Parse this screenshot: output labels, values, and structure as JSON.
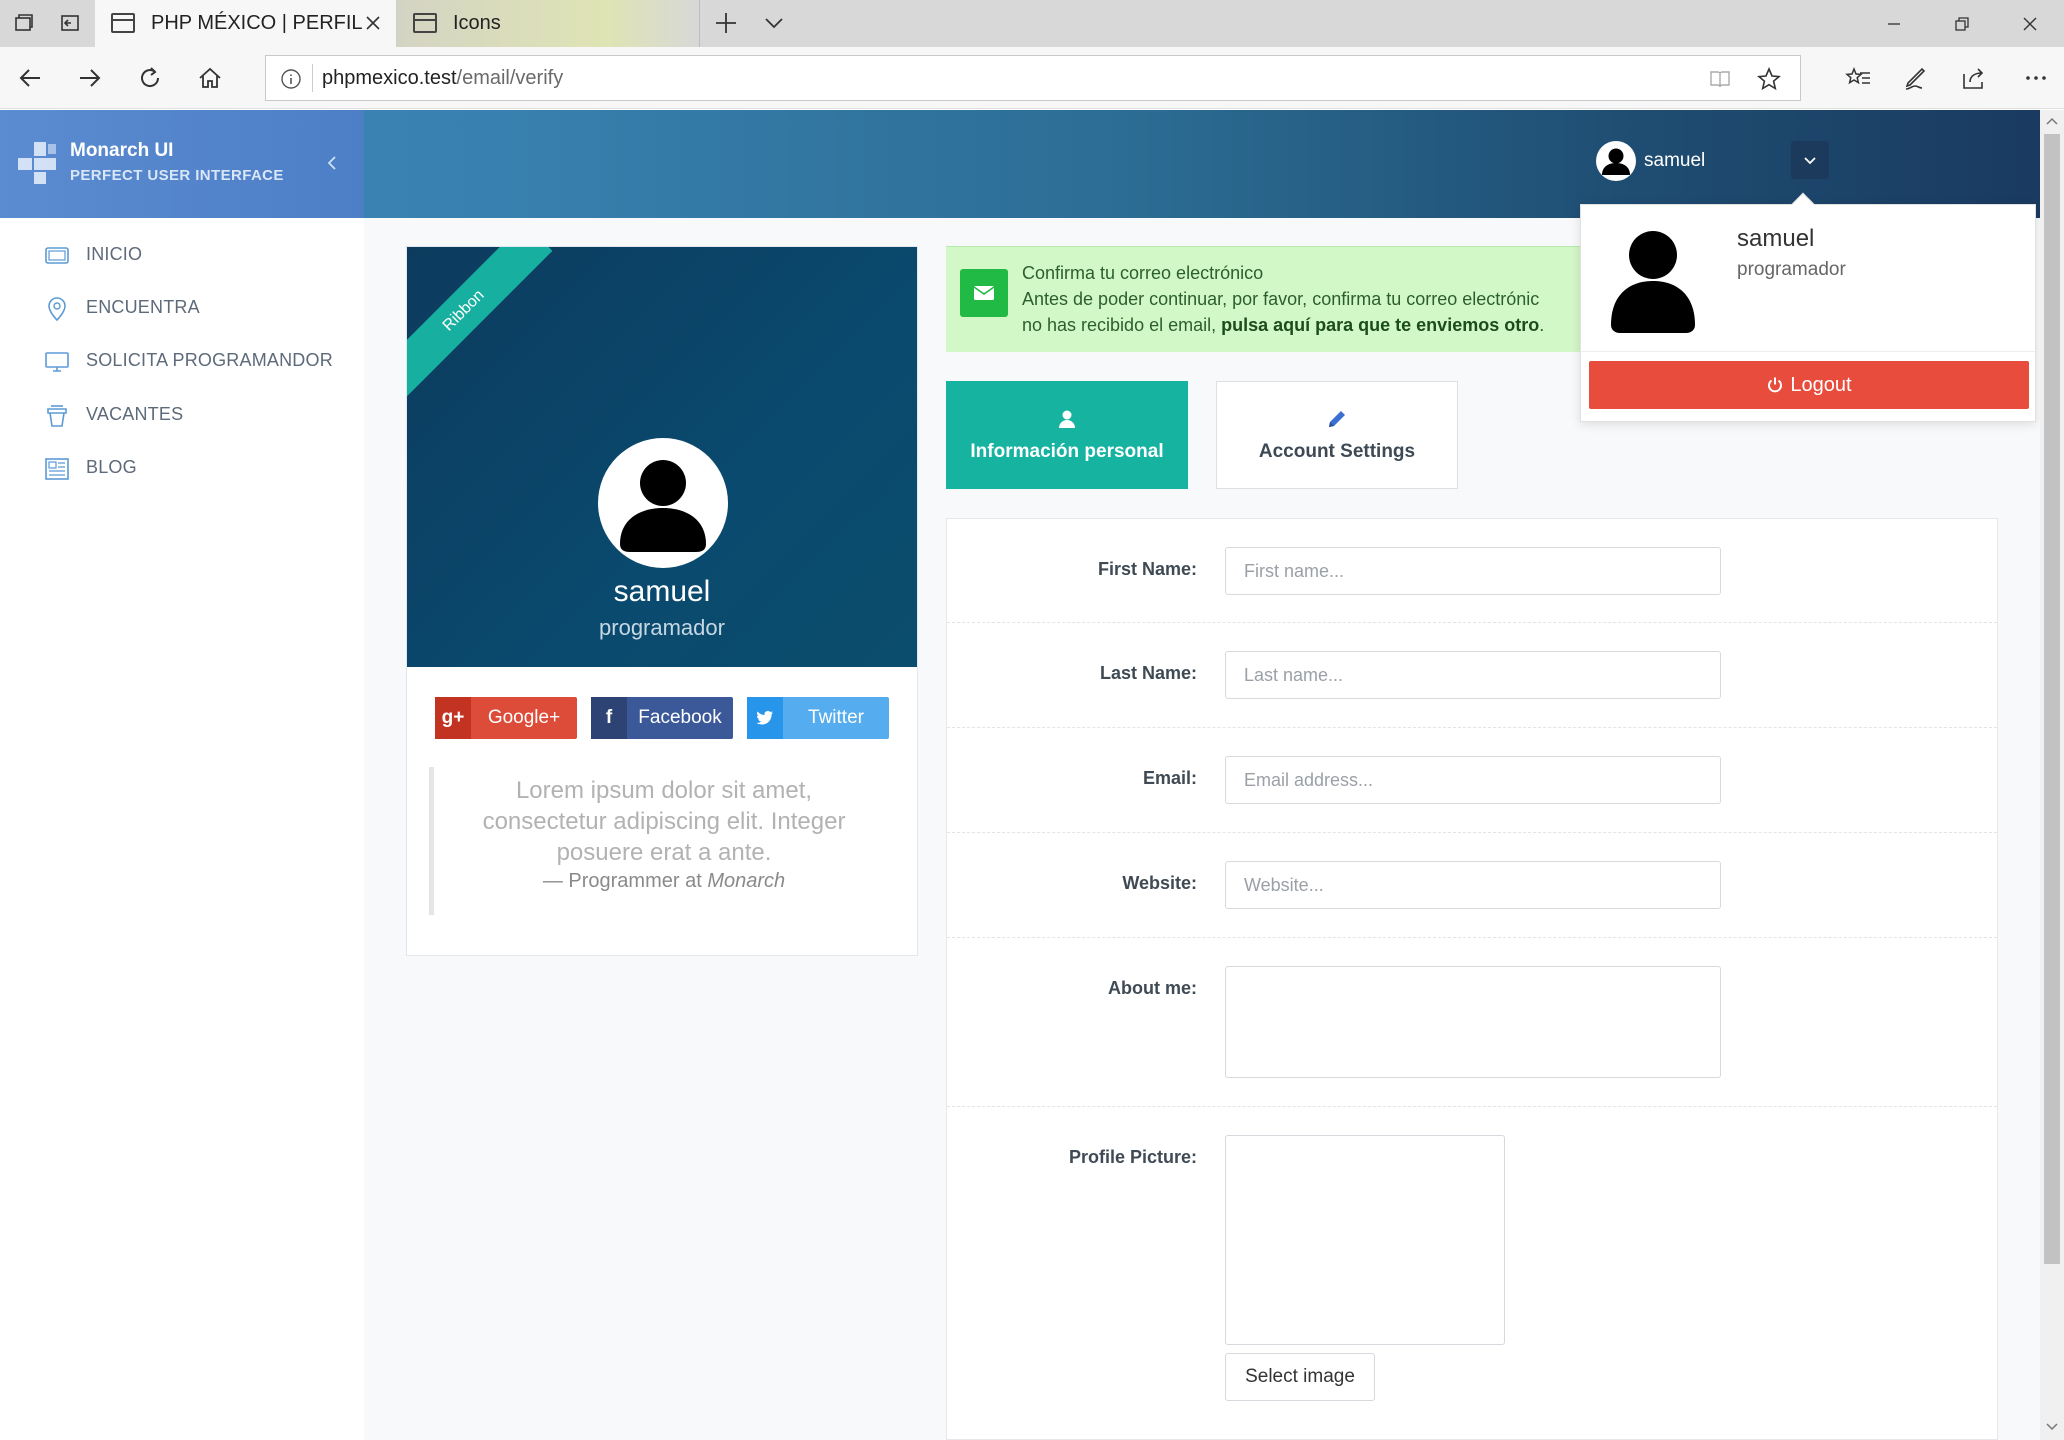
{
  "browser": {
    "tabs": [
      {
        "title": "PHP MÉXICO | PERFIL",
        "active": true
      },
      {
        "title": "Icons",
        "active": false
      }
    ],
    "url_host": "phpmexico.test",
    "url_path": "/email/verify",
    "icons": [
      "tab-set-aside-icon",
      "tab-preview-icon",
      "new-tab-icon",
      "tab-list-icon",
      "minimize-icon",
      "restore-icon",
      "close-window-icon",
      "back-icon",
      "forward-icon",
      "refresh-icon",
      "home-icon",
      "info-icon",
      "reading-view-icon",
      "favorite-star-icon",
      "favorites-hub-icon",
      "pen-icon",
      "share-icon",
      "more-icon"
    ]
  },
  "header": {
    "brand_title": "Monarch UI",
    "brand_subtitle": "PERFECT USER INTERFACE",
    "username": "samuel"
  },
  "sidebar": {
    "items": [
      {
        "label": "INICIO",
        "icon": "monitor-icon"
      },
      {
        "label": "ENCUENTRA",
        "icon": "location-pin-icon"
      },
      {
        "label": "SOLICITA PROGRAMANDOR",
        "icon": "desktop-icon"
      },
      {
        "label": "VACANTES",
        "icon": "coffee-cup-icon"
      },
      {
        "label": "BLOG",
        "icon": "newspaper-icon"
      }
    ]
  },
  "profile": {
    "ribbon": "Ribbon",
    "name": "samuel",
    "role": "programador",
    "social": [
      {
        "label": "Google+",
        "icon": "google-plus-icon",
        "color": "#dd4b39"
      },
      {
        "label": "Facebook",
        "icon": "facebook-icon",
        "color": "#3b5998"
      },
      {
        "label": "Twitter",
        "icon": "twitter-icon",
        "color": "#55acee"
      }
    ],
    "quote_text": "Lorem ipsum dolor sit amet, consectetur adipiscing elit. Integer posuere erat a ante.",
    "quote_foot_prefix": "— Programmer at",
    "quote_foot_company": "Monarch"
  },
  "alert": {
    "title": "Confirma tu correo electrónico",
    "line2": "Antes de poder continuar, por favor, confirma tu correo electrónic",
    "line3_prefix": "no has recibido el email,",
    "line3_link": "pulsa aquí para que te enviemos otro",
    "line3_suffix": ".",
    "color": "#21ba45"
  },
  "tabs": {
    "personal": "Información personal",
    "settings": "Account Settings"
  },
  "form": {
    "first_name_label": "First Name:",
    "first_name_placeholder": "First name...",
    "last_name_label": "Last Name:",
    "last_name_placeholder": "Last name...",
    "email_label": "Email:",
    "email_placeholder": "Email address...",
    "website_label": "Website:",
    "website_placeholder": "Website...",
    "about_label": "About me:",
    "picture_label": "Profile Picture:",
    "select_image": "Select image"
  },
  "dropdown": {
    "name": "samuel",
    "role": "programador",
    "logout": "Logout",
    "logout_color": "#e74c3c"
  },
  "colors": {
    "accent_teal": "#15b3a0",
    "header_start": "#3f87b8",
    "header_end": "#1a3a60",
    "hero": "#0a4a6e"
  }
}
